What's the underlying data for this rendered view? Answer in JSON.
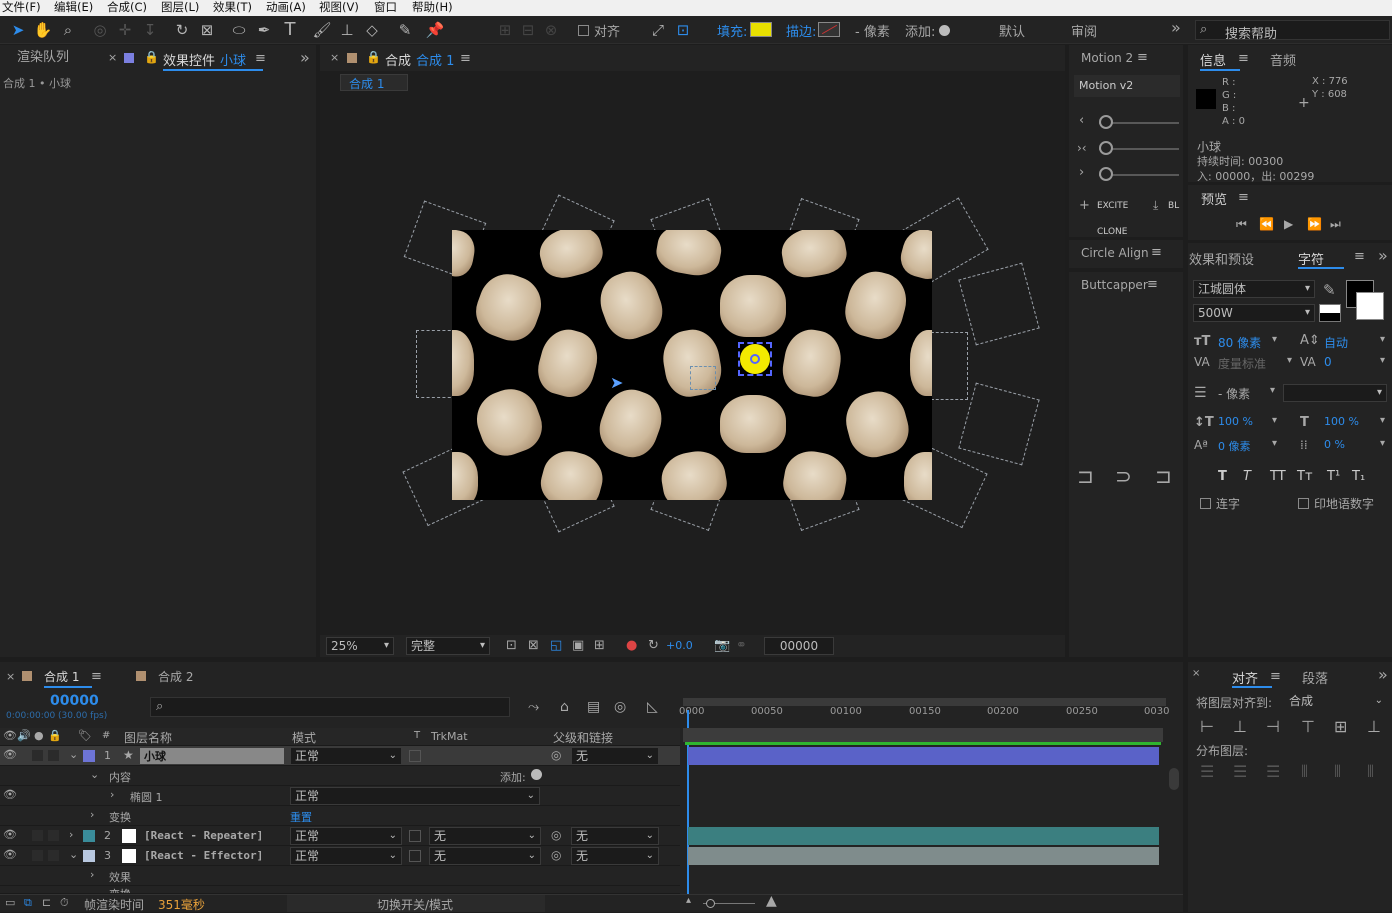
{
  "menu": [
    "文件(F)",
    "编辑(E)",
    "合成(C)",
    "图层(L)",
    "效果(T)",
    "动画(A)",
    "视图(V)",
    "窗口",
    "帮助(H)"
  ],
  "toolbar": {
    "align_label": "对齐",
    "fill_label": "填充:",
    "stroke_label": "描边:",
    "stroke_px": "- 像素",
    "add_label": "添加:",
    "workspace_default": "默认",
    "workspace_review": "审阅",
    "search_help": "搜索帮助",
    "fill_color": "#e8e000"
  },
  "left_panel": {
    "tab_render": "渲染队列",
    "tab_effects": "效果控件",
    "tab_effects_layer": "小球",
    "breadcrumb": "合成 1 • 小球"
  },
  "comp_panel": {
    "tab_prefix": "合成",
    "tab_name": "合成 1",
    "sub_tab": "合成 1",
    "zoom": "25%",
    "quality": "完整",
    "exposure": "+0.0",
    "timecode": "00000"
  },
  "motion": {
    "panel_title": "Motion 2",
    "version": "Motion v2",
    "excite": "EXCITE",
    "blend": "BL",
    "clone": "CLONE"
  },
  "circle_align": {
    "title": "Circle Align"
  },
  "buttcapper": {
    "title": "Buttcapper"
  },
  "info": {
    "tab_info": "信息",
    "tab_audio": "音频",
    "r": "R :",
    "g": "G :",
    "b": "B :",
    "a": "A :  0",
    "x": "X : 776",
    "y": "Y : 608",
    "layer": "小球",
    "duration": "持续时间: 00300",
    "inout": "入: 00000，出: 00299"
  },
  "preview": {
    "title": "预览"
  },
  "character": {
    "tab_effects_presets": "效果和预设",
    "tab_char": "字符",
    "font": "江城圆体",
    "weight": "500W",
    "size": "80 像素",
    "leading": "自动",
    "kerning": "度量标准",
    "tracking": "0",
    "stroke_width": "- 像素",
    "vscale": "100 %",
    "hscale": "100 %",
    "baseline": "0 像素",
    "tsume": "0 %",
    "ligatures": "连字",
    "hindi": "印地语数字",
    "styles": [
      "T",
      "T",
      "TT",
      "Tт",
      "T¹",
      "T₁"
    ]
  },
  "align": {
    "tab_align": "对齐",
    "tab_para": "段落",
    "align_to_label": "将图层对齐到:",
    "align_to_value": "合成",
    "distribute_label": "分布图层:"
  },
  "timeline": {
    "tab_comp1": "合成 1",
    "tab_comp2": "合成 2",
    "timecode": "00000",
    "timecode_sub": "0:00:00:00 (30.00 fps)",
    "col_name": "图层名称",
    "col_mode": "模式",
    "col_t": "T",
    "col_trkmat": "TrkMat",
    "col_parent": "父级和链接",
    "ruler": [
      "0000",
      "00050",
      "00100",
      "00150",
      "00200",
      "00250",
      "0030"
    ],
    "layers": [
      {
        "num": "1",
        "name": "小球",
        "mode": "正常",
        "trkmat": "",
        "parent": "无",
        "color": "#6d74d6",
        "bar_color": "#5a62c8"
      },
      {
        "num": "2",
        "name": "[React - Repeater]",
        "mode": "正常",
        "trkmat": "无",
        "parent": "无",
        "color": "#3a8c9a",
        "bar_color": "#3b7f80"
      },
      {
        "num": "3",
        "name": "[React - Effector]",
        "mode": "正常",
        "trkmat": "无",
        "parent": "无",
        "color": "#b8c8e0",
        "bar_color": "#7f8c8c"
      }
    ],
    "content_label": "内容",
    "add_label": "添加:",
    "ellipse_label": "椭圆 1",
    "ellipse_mode": "正常",
    "transform_label": "变换",
    "reset_label": "重置",
    "effects_label": "效果",
    "transform_label2": "变换",
    "render_time_label": "帧渲染时间",
    "render_time_value": "351毫秒",
    "toggle_label": "切换开关/模式"
  }
}
